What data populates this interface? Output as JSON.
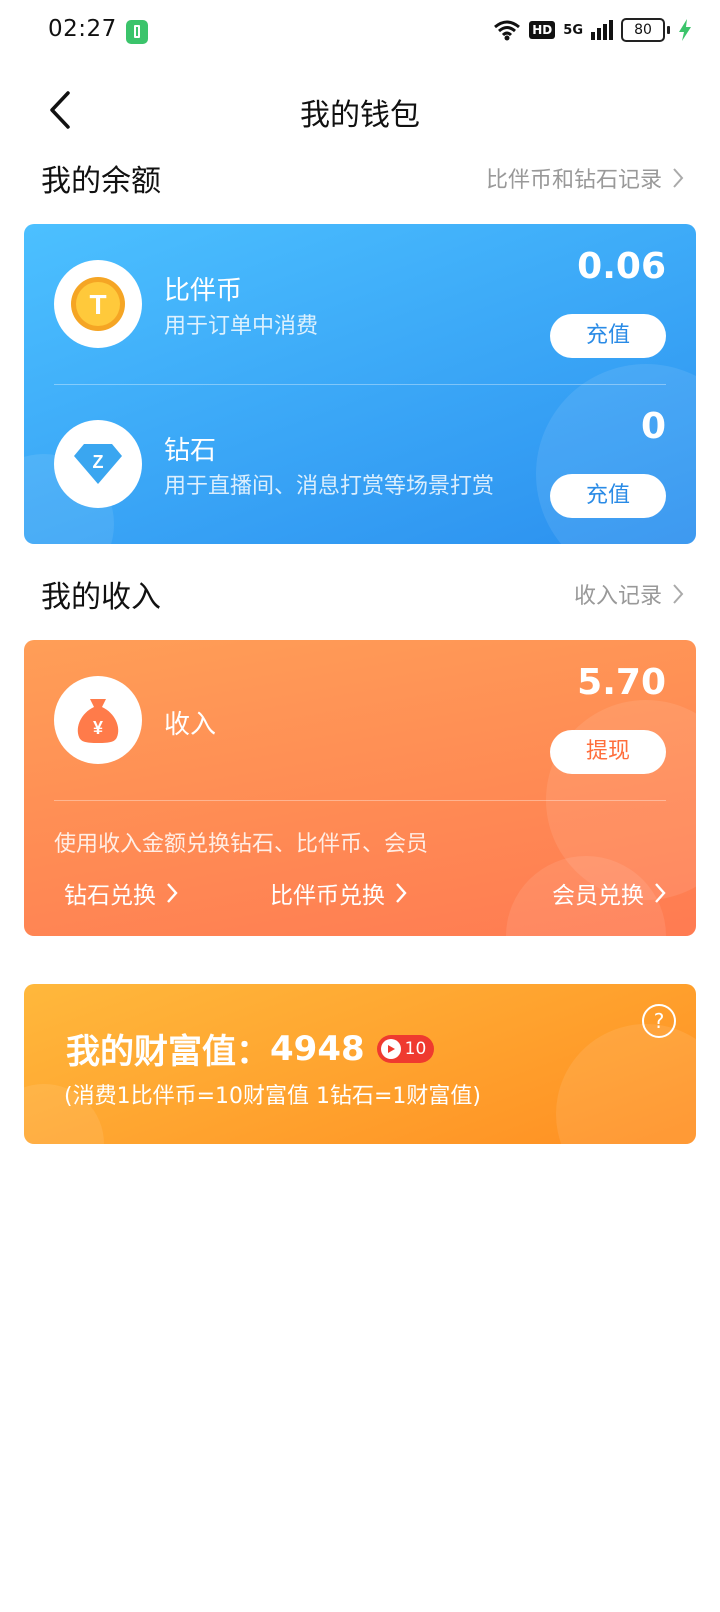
{
  "status_bar": {
    "time": "02:27",
    "network": "5G",
    "hd": "HD",
    "battery": "80"
  },
  "header": {
    "title": "我的钱包"
  },
  "balance_section": {
    "title": "我的余额",
    "link": "比伴币和钻石记录",
    "coin": {
      "name": "比伴币",
      "desc": "用于订单中消费",
      "amount": "0.06",
      "button": "充值",
      "icon_letter": "T"
    },
    "diamond": {
      "name": "钻石",
      "desc": "用于直播间、消息打赏等场景打赏",
      "amount": "0",
      "button": "充值",
      "icon_letter": "Z"
    }
  },
  "income_section": {
    "title": "我的收入",
    "link": "收入记录",
    "label": "收入",
    "amount": "5.70",
    "button": "提现",
    "hint": "使用收入金额兑换钻石、比伴币、会员",
    "exchanges": [
      "钻石兑换",
      "比伴币兑换",
      "会员兑换"
    ]
  },
  "wealth": {
    "title": "我的财富值：",
    "value": "4948",
    "level": "10",
    "note": "(消费1比伴币=10财富值 1钻石=1财富值)",
    "help": "?"
  },
  "colors": {
    "blue": "#2b90ef",
    "orange": "#ff7b52",
    "gold": "#ff8f22"
  }
}
